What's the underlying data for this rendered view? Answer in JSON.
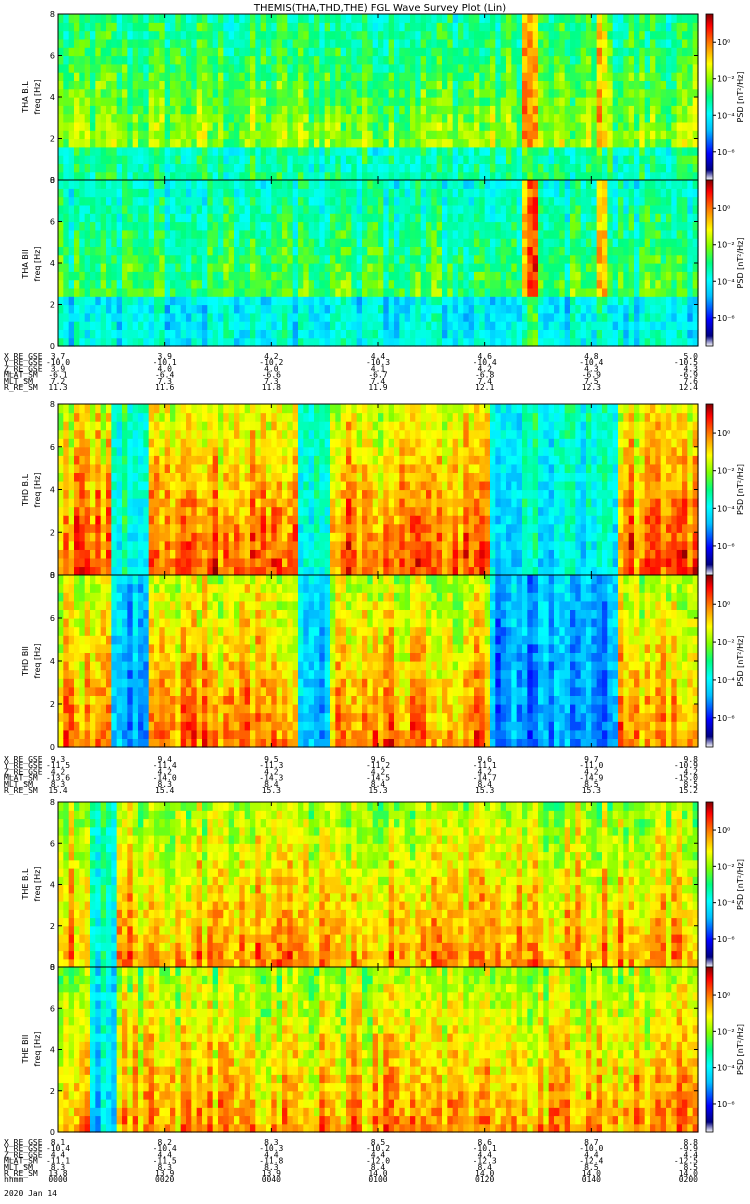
{
  "title": "THEMIS(THA,THD,THE) FGL Wave Survey Plot (Lin)",
  "colorbar": {
    "label": "PSD [nT²/Hz]",
    "tick_labels": [
      "10⁰",
      "10⁻²",
      "10⁻⁴",
      "10⁻⁶"
    ],
    "colors": [
      "#ffffff",
      "#000080",
      "#0000ff",
      "#00bfff",
      "#00ffff",
      "#00ff80",
      "#80ff00",
      "#ffff00",
      "#ff8000",
      "#ff0000",
      "#800000"
    ]
  },
  "freq_ticks": [
    "0",
    "2",
    "4",
    "6",
    "8"
  ],
  "panels": [
    {
      "id": "tha-bl",
      "label": "THA B.L",
      "ylabel": "freq [Hz]"
    },
    {
      "id": "tha-bii",
      "label": "THA BII",
      "ylabel": "freq [Hz]"
    },
    {
      "id": "thd-bl",
      "label": "THD B.L",
      "ylabel": "freq [Hz]"
    },
    {
      "id": "thd-bii",
      "label": "THD BII",
      "ylabel": "freq [Hz]"
    },
    {
      "id": "the-bl",
      "label": "THE B.L",
      "ylabel": "freq [Hz]"
    },
    {
      "id": "the-bii",
      "label": "THE BII",
      "ylabel": "freq [Hz]"
    }
  ],
  "ephemeris": [
    {
      "id": "tha",
      "rows": [
        {
          "label": "X_RE_GSE",
          "values": [
            "3.7",
            "3.9",
            "4.2",
            "4.4",
            "4.6",
            "4.8",
            "5.0"
          ]
        },
        {
          "label": "Y_RE_GSE",
          "values": [
            "-10.0",
            "-10.1",
            "-10.2",
            "-10.3",
            "-10.4",
            "-10.4",
            "-10.5"
          ]
        },
        {
          "label": "Z_RE_GSE",
          "values": [
            "3.9",
            "4.0",
            "4.0",
            "4.1",
            "4.2",
            "4.3",
            "4.3"
          ]
        },
        {
          "label": "MLAT_SM",
          "values": [
            "-6.1",
            "-6.4",
            "-6.6",
            "-6.7",
            "-6.8",
            "-6.9",
            "-6.9"
          ]
        },
        {
          "label": "MLT_SM",
          "values": [
            "7.2",
            "7.3",
            "7.3",
            "7.4",
            "7.4",
            "7.5",
            "7.6"
          ]
        },
        {
          "label": "R_RE_SM",
          "values": [
            "11.3",
            "11.6",
            "11.8",
            "11.9",
            "12.1",
            "12.3",
            "12.4"
          ]
        }
      ]
    },
    {
      "id": "thd",
      "rows": [
        {
          "label": "X_RE_GSE",
          "values": [
            "9.3",
            "9.4",
            "9.5",
            "9.6",
            "9.6",
            "9.7",
            "9.8"
          ]
        },
        {
          "label": "Y_RE_GSE",
          "values": [
            "-11.5",
            "-11.4",
            "-11.3",
            "-11.2",
            "-11.1",
            "-11.0",
            "-10.9"
          ]
        },
        {
          "label": "Z_RE_GSE",
          "values": [
            "4.2",
            "4.2",
            "4.2",
            "4.2",
            "4.2",
            "4.2",
            "4.2"
          ]
        },
        {
          "label": "MLAT_SM",
          "values": [
            "-13.6",
            "-14.0",
            "-14.3",
            "-14.5",
            "-14.7",
            "-14.9",
            "-15.0"
          ]
        },
        {
          "label": "MLT_SM",
          "values": [
            "8.3",
            "8.3",
            "8.4",
            "8.4",
            "8.4",
            "8.5",
            "8.5"
          ]
        },
        {
          "label": "R_RE_SM",
          "values": [
            "15.4",
            "15.4",
            "15.3",
            "15.3",
            "15.3",
            "15.3",
            "15.2"
          ]
        }
      ]
    },
    {
      "id": "the",
      "rows": [
        {
          "label": "X_RE_GSE",
          "values": [
            "8.1",
            "8.2",
            "8.3",
            "8.5",
            "8.6",
            "8.7",
            "8.8"
          ]
        },
        {
          "label": "Y_RE_GSE",
          "values": [
            "-10.4",
            "-10.4",
            "-10.3",
            "-10.2",
            "-10.1",
            "-10.0",
            "-9.9"
          ]
        },
        {
          "label": "Z_RE_GSE",
          "values": [
            "4.4",
            "4.4",
            "4.4",
            "4.4",
            "4.4",
            "4.4",
            "4.4"
          ]
        },
        {
          "label": "MLAT_SM",
          "values": [
            "-11.1",
            "-11.5",
            "-11.8",
            "-12.0",
            "-12.3",
            "-12.4",
            "-12.5"
          ]
        },
        {
          "label": "MLT_SM",
          "values": [
            "8.3",
            "8.3",
            "8.3",
            "8.4",
            "8.4",
            "8.5",
            "8.5"
          ]
        },
        {
          "label": "R_RE_SM",
          "values": [
            "13.8",
            "13.9",
            "13.9",
            "14.0",
            "14.0",
            "14.0",
            "14.0"
          ]
        },
        {
          "label": "hhmm",
          "values": [
            "0000",
            "0020",
            "0040",
            "0100",
            "0120",
            "0140",
            "0200"
          ]
        }
      ],
      "date": "2020 Jan 14"
    }
  ],
  "chart_data": {
    "type": "heatmap",
    "title": "THEMIS(THA,THD,THE) FGL Wave Survey Plot (Lin)",
    "xlabel": "hhmm",
    "x_ticks": [
      "0000",
      "0020",
      "0040",
      "0100",
      "0120",
      "0140",
      "0200"
    ],
    "xlim_minutes": [
      0,
      120
    ],
    "ylim": [
      0,
      8
    ],
    "ylabel": "freq [Hz]",
    "zlabel": "PSD [nT²/Hz]",
    "zscale": "log",
    "zlim": [
      1e-07,
      10
    ],
    "panels": [
      {
        "name": "THA B.L",
        "background_level": 0.55,
        "features": [
          {
            "type": "enhancement",
            "t_start_min": 87,
            "t_end_min": 90,
            "level": 0.78
          },
          {
            "type": "enhancement",
            "t_start_min": 101,
            "t_end_min": 103,
            "level": 0.75
          },
          {
            "type": "low_freq_depletion",
            "f_max_hz": 1.5,
            "level": 0.3
          }
        ]
      },
      {
        "name": "THA BII",
        "background_level": 0.5,
        "features": [
          {
            "type": "enhancement",
            "t_start_min": 87,
            "t_end_min": 90,
            "level": 0.8
          },
          {
            "type": "enhancement",
            "t_start_min": 101,
            "t_end_min": 103,
            "level": 0.76
          },
          {
            "type": "low_freq_depletion",
            "f_max_hz": 2.5,
            "level": 0.2
          }
        ]
      },
      {
        "name": "THD B.L",
        "background_level": 0.75,
        "features": [
          {
            "type": "quiet_interval",
            "t_start_min": 10,
            "t_end_min": 17,
            "level": 0.45
          },
          {
            "type": "quiet_interval",
            "t_start_min": 45,
            "t_end_min": 51,
            "level": 0.45
          },
          {
            "type": "quiet_interval",
            "t_start_min": 81,
            "t_end_min": 105,
            "level": 0.4
          }
        ]
      },
      {
        "name": "THD BII",
        "background_level": 0.72,
        "features": [
          {
            "type": "quiet_interval",
            "t_start_min": 10,
            "t_end_min": 17,
            "level": 0.3
          },
          {
            "type": "quiet_interval",
            "t_start_min": 45,
            "t_end_min": 51,
            "level": 0.3
          },
          {
            "type": "quiet_interval",
            "t_start_min": 81,
            "t_end_min": 105,
            "level": 0.25
          }
        ]
      },
      {
        "name": "THE B.L",
        "background_level": 0.7,
        "features": [
          {
            "type": "quiet_interval",
            "t_start_min": 6,
            "t_end_min": 11,
            "level": 0.45
          }
        ]
      },
      {
        "name": "THE BII",
        "background_level": 0.7,
        "features": [
          {
            "type": "quiet_interval",
            "t_start_min": 6,
            "t_end_min": 11,
            "level": 0.35
          }
        ]
      }
    ]
  }
}
